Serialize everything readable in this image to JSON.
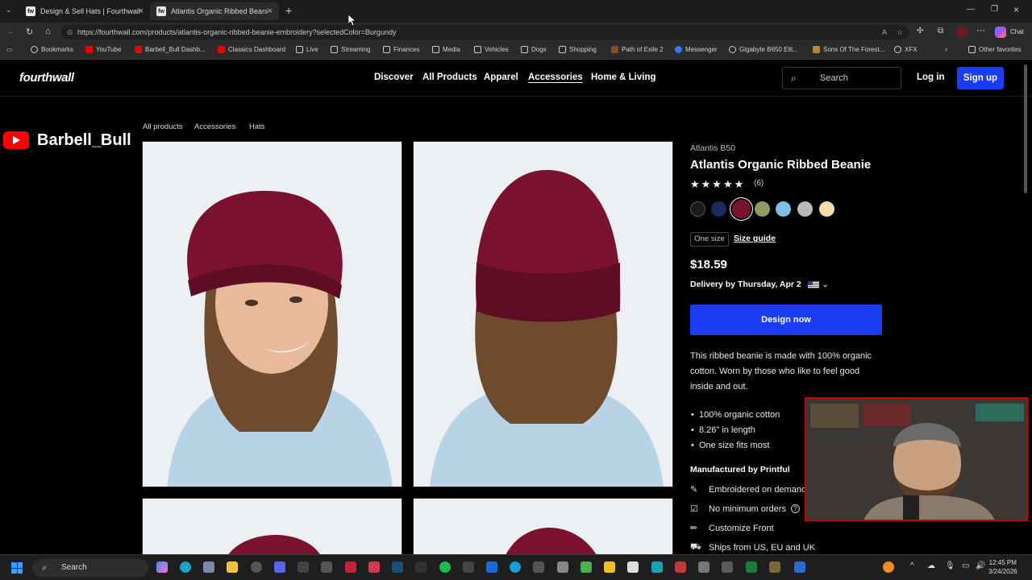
{
  "browser": {
    "tabs": [
      {
        "label": "Design & Sell Hats | Fourthwall",
        "active": false
      },
      {
        "label": "Atlantis Organic Ribbed Beanie | F",
        "active": true
      }
    ],
    "url": "https://fourthwall.com/products/atlantis-organic-ribbed-beanie-embroidery?selectedColor=Burgundy",
    "bookmarks": [
      "Bookmarks",
      "YouTube",
      "Barbell_Bull Dashb...",
      "Classics Dashboard",
      "Live",
      "Streaming",
      "Finances",
      "Media",
      "Vehicles",
      "Dogs",
      "Shopping",
      "Path of Exile 2",
      "Messenger",
      "Gigabyte B650 Elit...",
      "Sons Of The Forest...",
      "XFX",
      "Other favorites"
    ],
    "chat_label": "Chat"
  },
  "site": {
    "logo": "fourthwall",
    "nav": [
      "Discover",
      "All Products",
      "Apparel",
      "Accessories",
      "Home & Living"
    ],
    "active_nav": "Accessories",
    "search_placeholder": "Search",
    "login": "Log in",
    "signup": "Sign up"
  },
  "breadcrumb": [
    "All products",
    "Accessories",
    "Hats"
  ],
  "product": {
    "brand": "Atlantis B50",
    "title": "Atlantis Organic Ribbed Beanie",
    "stars": "★★★★★",
    "rating_count": "(6)",
    "swatches": [
      "#1a1a1a",
      "#1c2b5e",
      "#7a1230",
      "#8f9b62",
      "#7ec0e6",
      "#b9b9b9",
      "#f3dca8"
    ],
    "selected_swatch": 2,
    "size": "One size",
    "size_guide": "Size guide",
    "price": "$18.59",
    "delivery": "Delivery by Thursday, Apr 2",
    "cta": "Design now",
    "description": "This ribbed beanie is made with 100% organic cotton. Worn by those who like to feel good inside and out.",
    "bullets": [
      "100% organic cotton",
      "8.26\" in length",
      "One size fits most"
    ],
    "manufacturer": "Manufactured by Printful",
    "features": [
      {
        "icon": "needle-icon",
        "label": "Embroidered on demand"
      },
      {
        "icon": "checkbox-icon",
        "label": "No minimum orders"
      },
      {
        "icon": "pencil-icon",
        "label": "Customize Front"
      },
      {
        "icon": "truck-icon",
        "label": "Ships from US, EU and UK"
      }
    ]
  },
  "overlay": {
    "channel": "Barbell_Bull"
  },
  "taskbar": {
    "search": "Search",
    "time": "12:45 PM",
    "date": "3/24/2026"
  },
  "colors": {
    "accent": "#1a3df2",
    "burgundy": "#7a1230",
    "hoodie": "#b9d3e6"
  }
}
